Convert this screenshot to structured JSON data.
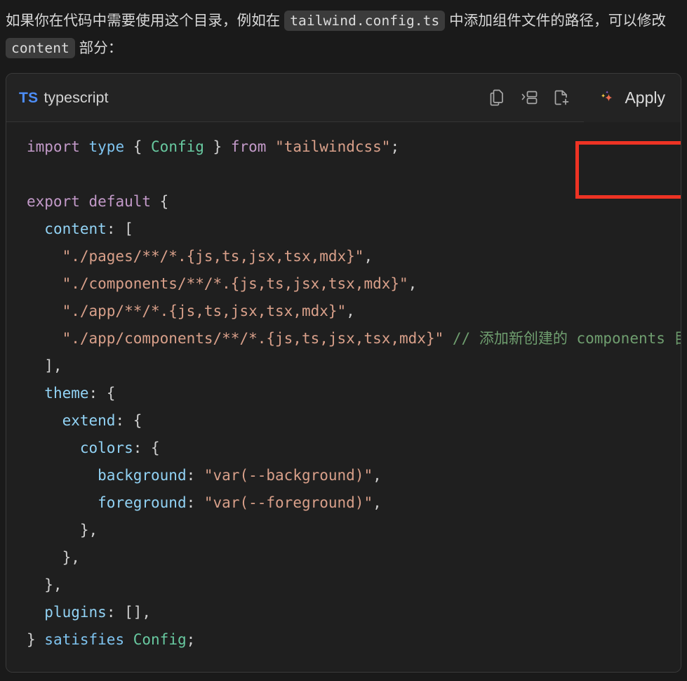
{
  "intro": {
    "segment_1": "如果你在代码中需要使用这个目录，例如在 ",
    "code_1": "tailwind.config.ts",
    "segment_2": " 中添加组件文件的路径，可以修改 ",
    "code_2": "content",
    "segment_3": " 部分："
  },
  "code_block": {
    "language_badge": "TS",
    "language_name": "typescript",
    "actions": {
      "copy_icon": "copy-icon",
      "insert_icon": "insert-at-cursor-icon",
      "new_file_icon": "new-file-icon",
      "apply_label": "Apply",
      "apply_sparkle_icon": "sparkle-icon"
    },
    "annotation": {
      "type": "rectangle-highlight",
      "target": "apply-button",
      "color": "#ee3324"
    },
    "colors": {
      "page_background": "#1a1a1a",
      "block_background": "#1f1f1f",
      "header_background": "#232323",
      "border": "#3a3a3a",
      "badge_blue": "#4d8df6",
      "keyword": "#c39ac9",
      "type_keyword": "#7fc4f0",
      "class_name": "#68c9a0",
      "string": "#d9a08a",
      "property": "#92d3f5",
      "comment": "#6f9e6f"
    },
    "lines": [
      [
        {
          "t": "import",
          "c": "tok-kw"
        },
        {
          "t": " ",
          "c": "tok-punc"
        },
        {
          "t": "type",
          "c": "tok-type-kw"
        },
        {
          "t": " { ",
          "c": "tok-punc"
        },
        {
          "t": "Config",
          "c": "tok-class"
        },
        {
          "t": " } ",
          "c": "tok-punc"
        },
        {
          "t": "from",
          "c": "tok-kw"
        },
        {
          "t": " ",
          "c": "tok-punc"
        },
        {
          "t": "\"tailwindcss\"",
          "c": "tok-str"
        },
        {
          "t": ";",
          "c": "tok-punc"
        }
      ],
      [],
      [
        {
          "t": "export",
          "c": "tok-kw"
        },
        {
          "t": " ",
          "c": "tok-punc"
        },
        {
          "t": "default",
          "c": "tok-kw"
        },
        {
          "t": " {",
          "c": "tok-punc"
        }
      ],
      [
        {
          "t": "  ",
          "c": "tok-punc"
        },
        {
          "t": "content",
          "c": "tok-prop"
        },
        {
          "t": ": [",
          "c": "tok-punc"
        }
      ],
      [
        {
          "t": "    ",
          "c": "tok-punc"
        },
        {
          "t": "\"./pages/**/*.{js,ts,jsx,tsx,mdx}\"",
          "c": "tok-str"
        },
        {
          "t": ",",
          "c": "tok-punc"
        }
      ],
      [
        {
          "t": "    ",
          "c": "tok-punc"
        },
        {
          "t": "\"./components/**/*.{js,ts,jsx,tsx,mdx}\"",
          "c": "tok-str"
        },
        {
          "t": ",",
          "c": "tok-punc"
        }
      ],
      [
        {
          "t": "    ",
          "c": "tok-punc"
        },
        {
          "t": "\"./app/**/*.{js,ts,jsx,tsx,mdx}\"",
          "c": "tok-str"
        },
        {
          "t": ",",
          "c": "tok-punc"
        }
      ],
      [
        {
          "t": "    ",
          "c": "tok-punc"
        },
        {
          "t": "\"./app/components/**/*.{js,ts,jsx,tsx,mdx}\"",
          "c": "tok-str"
        },
        {
          "t": " ",
          "c": "tok-punc"
        },
        {
          "t": "// 添加新创建的 components 目录",
          "c": "tok-comment"
        }
      ],
      [
        {
          "t": "  ],",
          "c": "tok-punc"
        }
      ],
      [
        {
          "t": "  ",
          "c": "tok-punc"
        },
        {
          "t": "theme",
          "c": "tok-prop"
        },
        {
          "t": ": {",
          "c": "tok-punc"
        }
      ],
      [
        {
          "t": "    ",
          "c": "tok-punc"
        },
        {
          "t": "extend",
          "c": "tok-prop"
        },
        {
          "t": ": {",
          "c": "tok-punc"
        }
      ],
      [
        {
          "t": "      ",
          "c": "tok-punc"
        },
        {
          "t": "colors",
          "c": "tok-prop"
        },
        {
          "t": ": {",
          "c": "tok-punc"
        }
      ],
      [
        {
          "t": "        ",
          "c": "tok-punc"
        },
        {
          "t": "background",
          "c": "tok-prop"
        },
        {
          "t": ": ",
          "c": "tok-punc"
        },
        {
          "t": "\"var(--background)\"",
          "c": "tok-str"
        },
        {
          "t": ",",
          "c": "tok-punc"
        }
      ],
      [
        {
          "t": "        ",
          "c": "tok-punc"
        },
        {
          "t": "foreground",
          "c": "tok-prop"
        },
        {
          "t": ": ",
          "c": "tok-punc"
        },
        {
          "t": "\"var(--foreground)\"",
          "c": "tok-str"
        },
        {
          "t": ",",
          "c": "tok-punc"
        }
      ],
      [
        {
          "t": "      },",
          "c": "tok-punc"
        }
      ],
      [
        {
          "t": "    },",
          "c": "tok-punc"
        }
      ],
      [
        {
          "t": "  },",
          "c": "tok-punc"
        }
      ],
      [
        {
          "t": "  ",
          "c": "tok-punc"
        },
        {
          "t": "plugins",
          "c": "tok-prop"
        },
        {
          "t": ": [],",
          "c": "tok-punc"
        }
      ],
      [
        {
          "t": "} ",
          "c": "tok-punc"
        },
        {
          "t": "satisfies",
          "c": "tok-type-kw"
        },
        {
          "t": " ",
          "c": "tok-punc"
        },
        {
          "t": "Config",
          "c": "tok-class"
        },
        {
          "t": ";",
          "c": "tok-punc"
        }
      ]
    ]
  }
}
